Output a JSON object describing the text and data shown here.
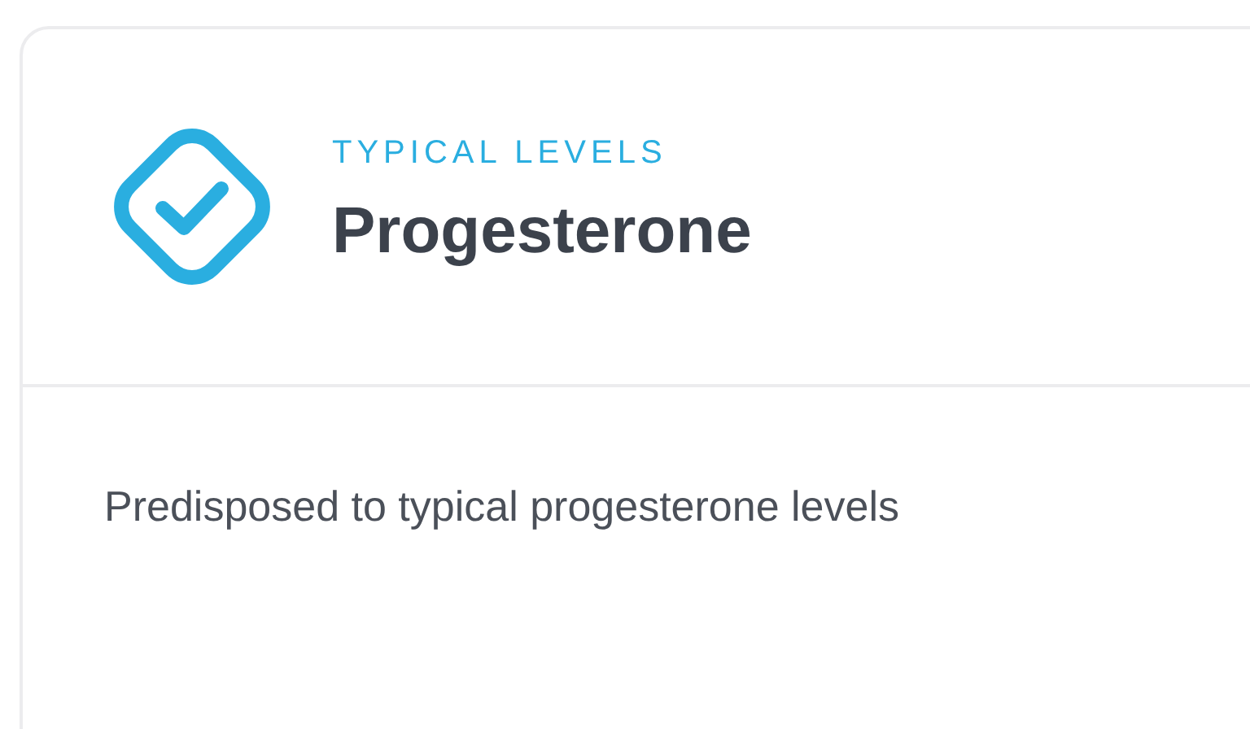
{
  "card": {
    "status": "TYPICAL LEVELS",
    "title": "Progesterone",
    "description": "Predisposed to typical progesterone levels"
  }
}
